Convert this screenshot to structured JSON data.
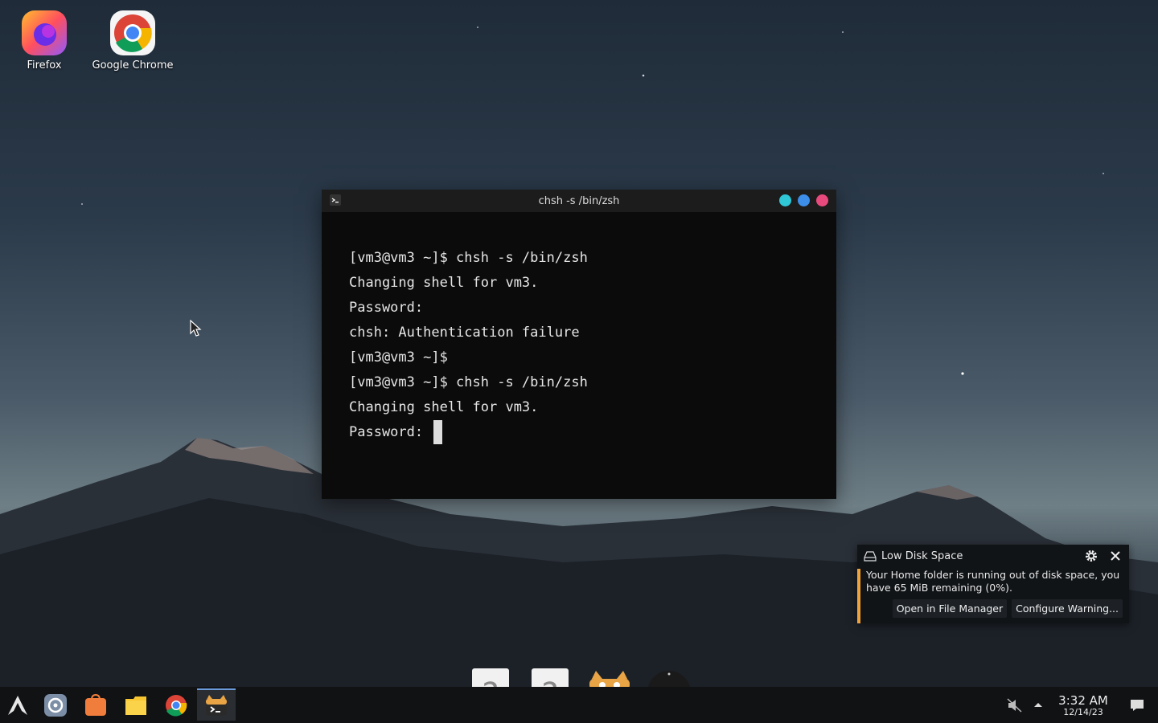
{
  "desktop": {
    "icons": [
      {
        "label": "Firefox"
      },
      {
        "label": "Google Chrome"
      }
    ]
  },
  "terminal": {
    "title": "chsh -s /bin/zsh",
    "lines": [
      "[vm3@vm3 ~]$ chsh -s /bin/zsh",
      "Changing shell for vm3.",
      "Password:",
      "chsh: Authentication failure",
      "[vm3@vm3 ~]$",
      "[vm3@vm3 ~]$ chsh -s /bin/zsh",
      "Changing shell for vm3.",
      "Password: "
    ],
    "buttons": {
      "minimize_color": "#2fc6d6",
      "maximize_color": "#3d8ee8",
      "close_color": "#e94a7d"
    }
  },
  "notification": {
    "title": "Low Disk Space",
    "body": "Your Home folder is running out of disk space, you have 65 MiB remaining (0%).",
    "actions": [
      "Open in File Manager",
      "Configure Warning..."
    ],
    "accent": "#f0a23b"
  },
  "taskbar": {
    "clock_time": "3:32 AM",
    "clock_date": "12/14/23"
  }
}
